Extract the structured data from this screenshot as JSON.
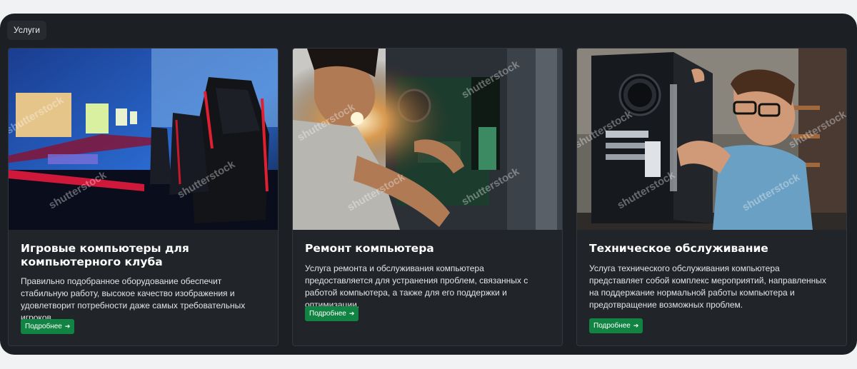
{
  "section": {
    "label": "Услуги"
  },
  "cards": [
    {
      "title": "Игровые компьютеры для компьютерного клуба",
      "text": "Правильно подобранное оборудование обеспечит стабильную работу, высокое качество изображения и удовлетворит потребности даже самых требовательных игроков.",
      "button": "Подробнее",
      "image_icon": "gaming-club-photo"
    },
    {
      "title": "Ремонт компьютера",
      "text": "Услуга ремонта и обслуживания компьютера предоставляется для устранения проблем, связанных с работой компьютера, а также для его поддержки и оптимизации.",
      "button": "Подробнее",
      "image_icon": "computer-repair-photo"
    },
    {
      "title": "Техническое обслуживание",
      "text": "Услуга технического обслуживания компьютера представляет собой комплекс мероприятий, направленных на поддержание нормальной работы компьютера и предотвращение возможных проблем.",
      "button": "Подробнее",
      "image_icon": "computer-maintenance-photo"
    }
  ],
  "button_arrow": "➔",
  "watermark": "shutterstock",
  "colors": {
    "page_bg": "#f1f2f4",
    "panel_bg": "#1c1f23",
    "card_bg": "#212429",
    "button_bg": "#118443"
  }
}
